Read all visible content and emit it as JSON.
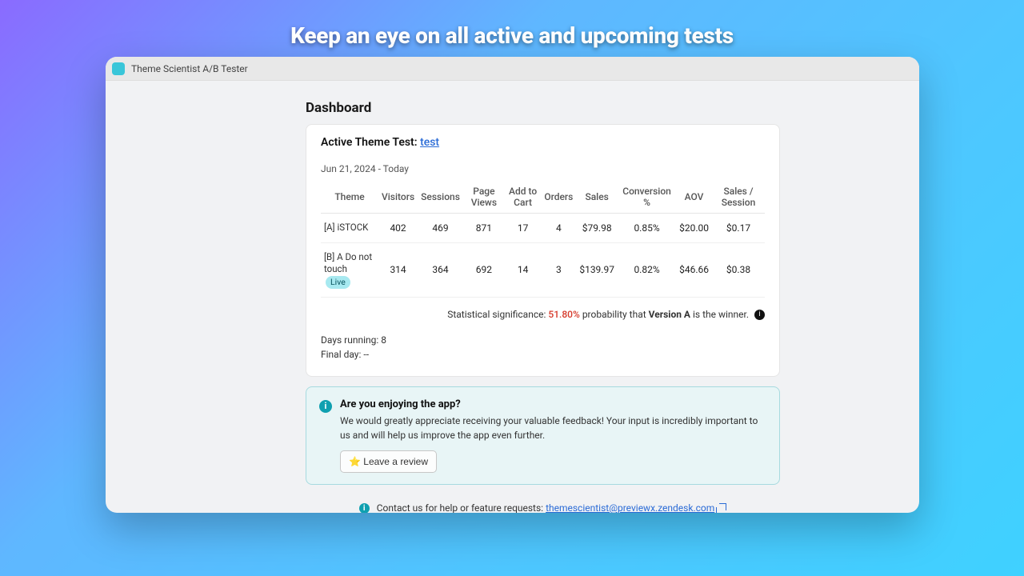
{
  "hero": "Keep an eye on all active and upcoming tests",
  "titlebar": {
    "app_name": "Theme Scientist A/B Tester"
  },
  "page": {
    "title": "Dashboard"
  },
  "active_test": {
    "label": "Active Theme Test:",
    "link_text": "test",
    "date_range": "Jun 21, 2024 - Today",
    "columns": [
      "Theme",
      "Visitors",
      "Sessions",
      "Page Views",
      "Add to Cart",
      "Orders",
      "Sales",
      "Conversion %",
      "AOV",
      "Sales / Session"
    ],
    "rows": [
      {
        "theme": "[A] iSTOCK",
        "live": false,
        "visitors": "402",
        "sessions": "469",
        "page_views": "871",
        "add_to_cart": "17",
        "orders": "4",
        "sales": "$79.98",
        "conversion": "0.85%",
        "aov": "$20.00",
        "sales_session": "$0.17"
      },
      {
        "theme": "[B] A Do not touch",
        "live": true,
        "visitors": "314",
        "sessions": "364",
        "page_views": "692",
        "add_to_cart": "14",
        "orders": "3",
        "sales": "$139.97",
        "conversion": "0.82%",
        "aov": "$46.66",
        "sales_session": "$0.38"
      }
    ],
    "live_badge": "Live",
    "significance": {
      "prefix": "Statistical significance:",
      "percent": "51.80%",
      "middle": "probability that",
      "winner": "Version A",
      "suffix": "is the winner."
    },
    "days_running_label": "Days running:",
    "days_running_value": "8",
    "final_day_label": "Final day:",
    "final_day_value": "--"
  },
  "feedback": {
    "title": "Are you enjoying the app?",
    "text": "We would greatly appreciate receiving your valuable feedback! Your input is incredibly important to us and will help us improve the app even further.",
    "button": "⭐ Leave a review"
  },
  "contact": {
    "prefix": "Contact us for help or feature requests:",
    "email": "themescientist@previewx.zendesk.com"
  }
}
